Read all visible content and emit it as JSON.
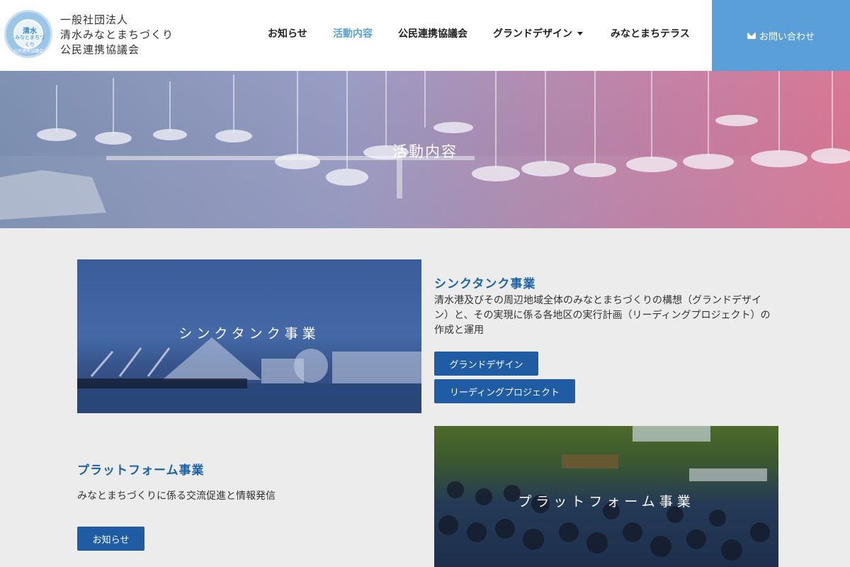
{
  "header": {
    "logo_text_top": "清水",
    "logo_text_mid": "みなとまちづくり",
    "logo_ring_bottom": "公民連携協議会",
    "org_line1": "一般社団法人",
    "org_line2": "清水みなとまちづくり",
    "org_line3": "公民連携協議会",
    "nav": [
      {
        "label": "お知らせ"
      },
      {
        "label": "活動内容"
      },
      {
        "label": "公民連携協議会"
      },
      {
        "label": "グランドデザイン"
      },
      {
        "label": "みなとまちテラス"
      }
    ],
    "contact_label": "お問い合わせ"
  },
  "hero": {
    "title": "活動内容"
  },
  "section1": {
    "image_label": "シンクタンク事業",
    "title": "シンクタンク事業",
    "desc_line1": "清水港及びその周辺地域全体のみなとまちづくりの構想（グランドデザイ",
    "desc_line2": "ン）と、その実現に係る各地区の実行計画（リーディングプロジェクト）の",
    "desc_line3": "作成と運用",
    "btn1": "グランドデザイン",
    "btn2": "リーディングプロジェクト"
  },
  "section2": {
    "title": "プラットフォーム事業",
    "desc": "みなとまちづくりに係る交流促進と情報発信",
    "btn": "お知らせ",
    "image_label": "プラットフォーム事業"
  },
  "colors": {
    "accent": "#1f5ca4",
    "nav_active": "#5ba0d4",
    "contact_bg": "#5b9fd8",
    "page_bg": "#ececec"
  }
}
